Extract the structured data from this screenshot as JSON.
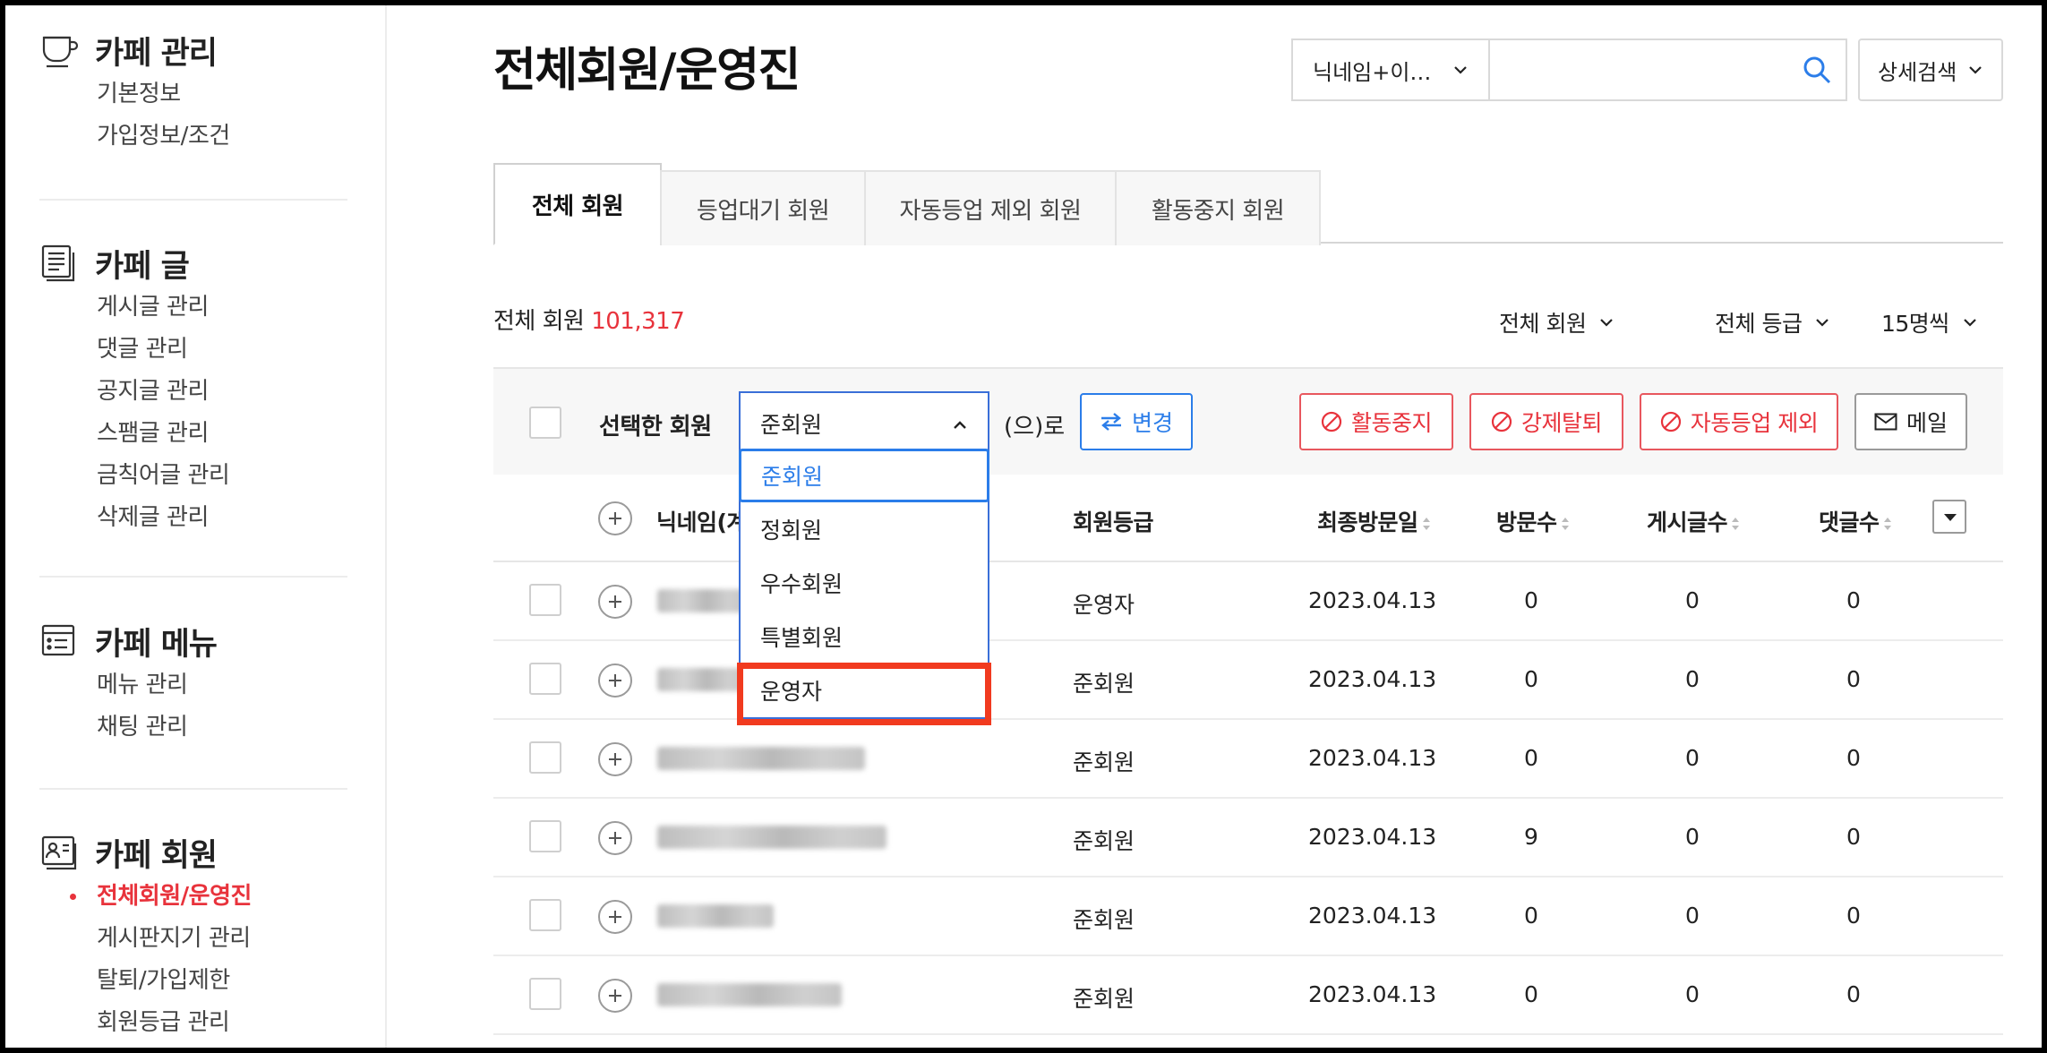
{
  "sidebar": {
    "sections": [
      {
        "title": "카페 관리",
        "icon": "cafe-cup-icon",
        "items": [
          "기본정보",
          "가입정보/조건"
        ]
      },
      {
        "title": "카페 글",
        "icon": "document-icon",
        "items": [
          "게시글 관리",
          "댓글 관리",
          "공지글 관리",
          "스팸글 관리",
          "금칙어글 관리",
          "삭제글 관리"
        ]
      },
      {
        "title": "카페 메뉴",
        "icon": "menu-list-icon",
        "items": [
          "메뉴 관리",
          "채팅 관리"
        ]
      },
      {
        "title": "카페 회원",
        "icon": "member-card-icon",
        "items": [
          "전체회원/운영진",
          "게시판지기 관리",
          "탈퇴/가입제한",
          "회원등급 관리"
        ],
        "active_item": "전체회원/운영진"
      }
    ]
  },
  "header": {
    "page_title": "전체회원/운영진",
    "search_type": "닉네임+이…",
    "search_value": "",
    "search_icon": "search-icon",
    "detail_search": "상세검색"
  },
  "tabs": [
    "전체 회원",
    "등업대기 회원",
    "자동등업 제외 회원",
    "활동중지 회원"
  ],
  "summary": {
    "label": "전체 회원",
    "count": "101,317"
  },
  "filters": {
    "member_type": "전체 회원",
    "grade": "전체 등급",
    "per_page": "15명씩"
  },
  "action_bar": {
    "selected_label": "선택한 회원",
    "grade_value": "준회원",
    "suffix": "(으)로",
    "change_label": "변경",
    "suspend_label": "활동중지",
    "expel_label": "강제탈퇴",
    "exclude_label": "자동등업 제외",
    "mail_label": "메일"
  },
  "grade_options": [
    "준회원",
    "정회원",
    "우수회원",
    "특별회원",
    "운영자"
  ],
  "grade_option_selected": "준회원",
  "grade_option_highlighted": "운영자",
  "table": {
    "headers": {
      "nickname": "닉네임(계",
      "grade": "회원등급",
      "last_visit": "최종방문일",
      "visits": "방문수",
      "posts": "게시글수",
      "comments": "댓글수"
    },
    "rows": [
      {
        "grade": "운영자",
        "last_visit": "2023.04.13",
        "visits": "0",
        "posts": "0",
        "comments": "0"
      },
      {
        "grade": "준회원",
        "last_visit": "2023.04.13",
        "visits": "0",
        "posts": "0",
        "comments": "0"
      },
      {
        "grade": "준회원",
        "last_visit": "2023.04.13",
        "visits": "0",
        "posts": "0",
        "comments": "0"
      },
      {
        "grade": "준회원",
        "last_visit": "2023.04.13",
        "visits": "9",
        "posts": "0",
        "comments": "0"
      },
      {
        "grade": "준회원",
        "last_visit": "2023.04.13",
        "visits": "0",
        "posts": "0",
        "comments": "0"
      },
      {
        "grade": "준회원",
        "last_visit": "2023.04.13",
        "visits": "0",
        "posts": "0",
        "comments": "0"
      }
    ]
  },
  "colors": {
    "accent_red": "#e8333c",
    "accent_blue": "#2b7de9",
    "highlight_box": "#f13a1f"
  }
}
